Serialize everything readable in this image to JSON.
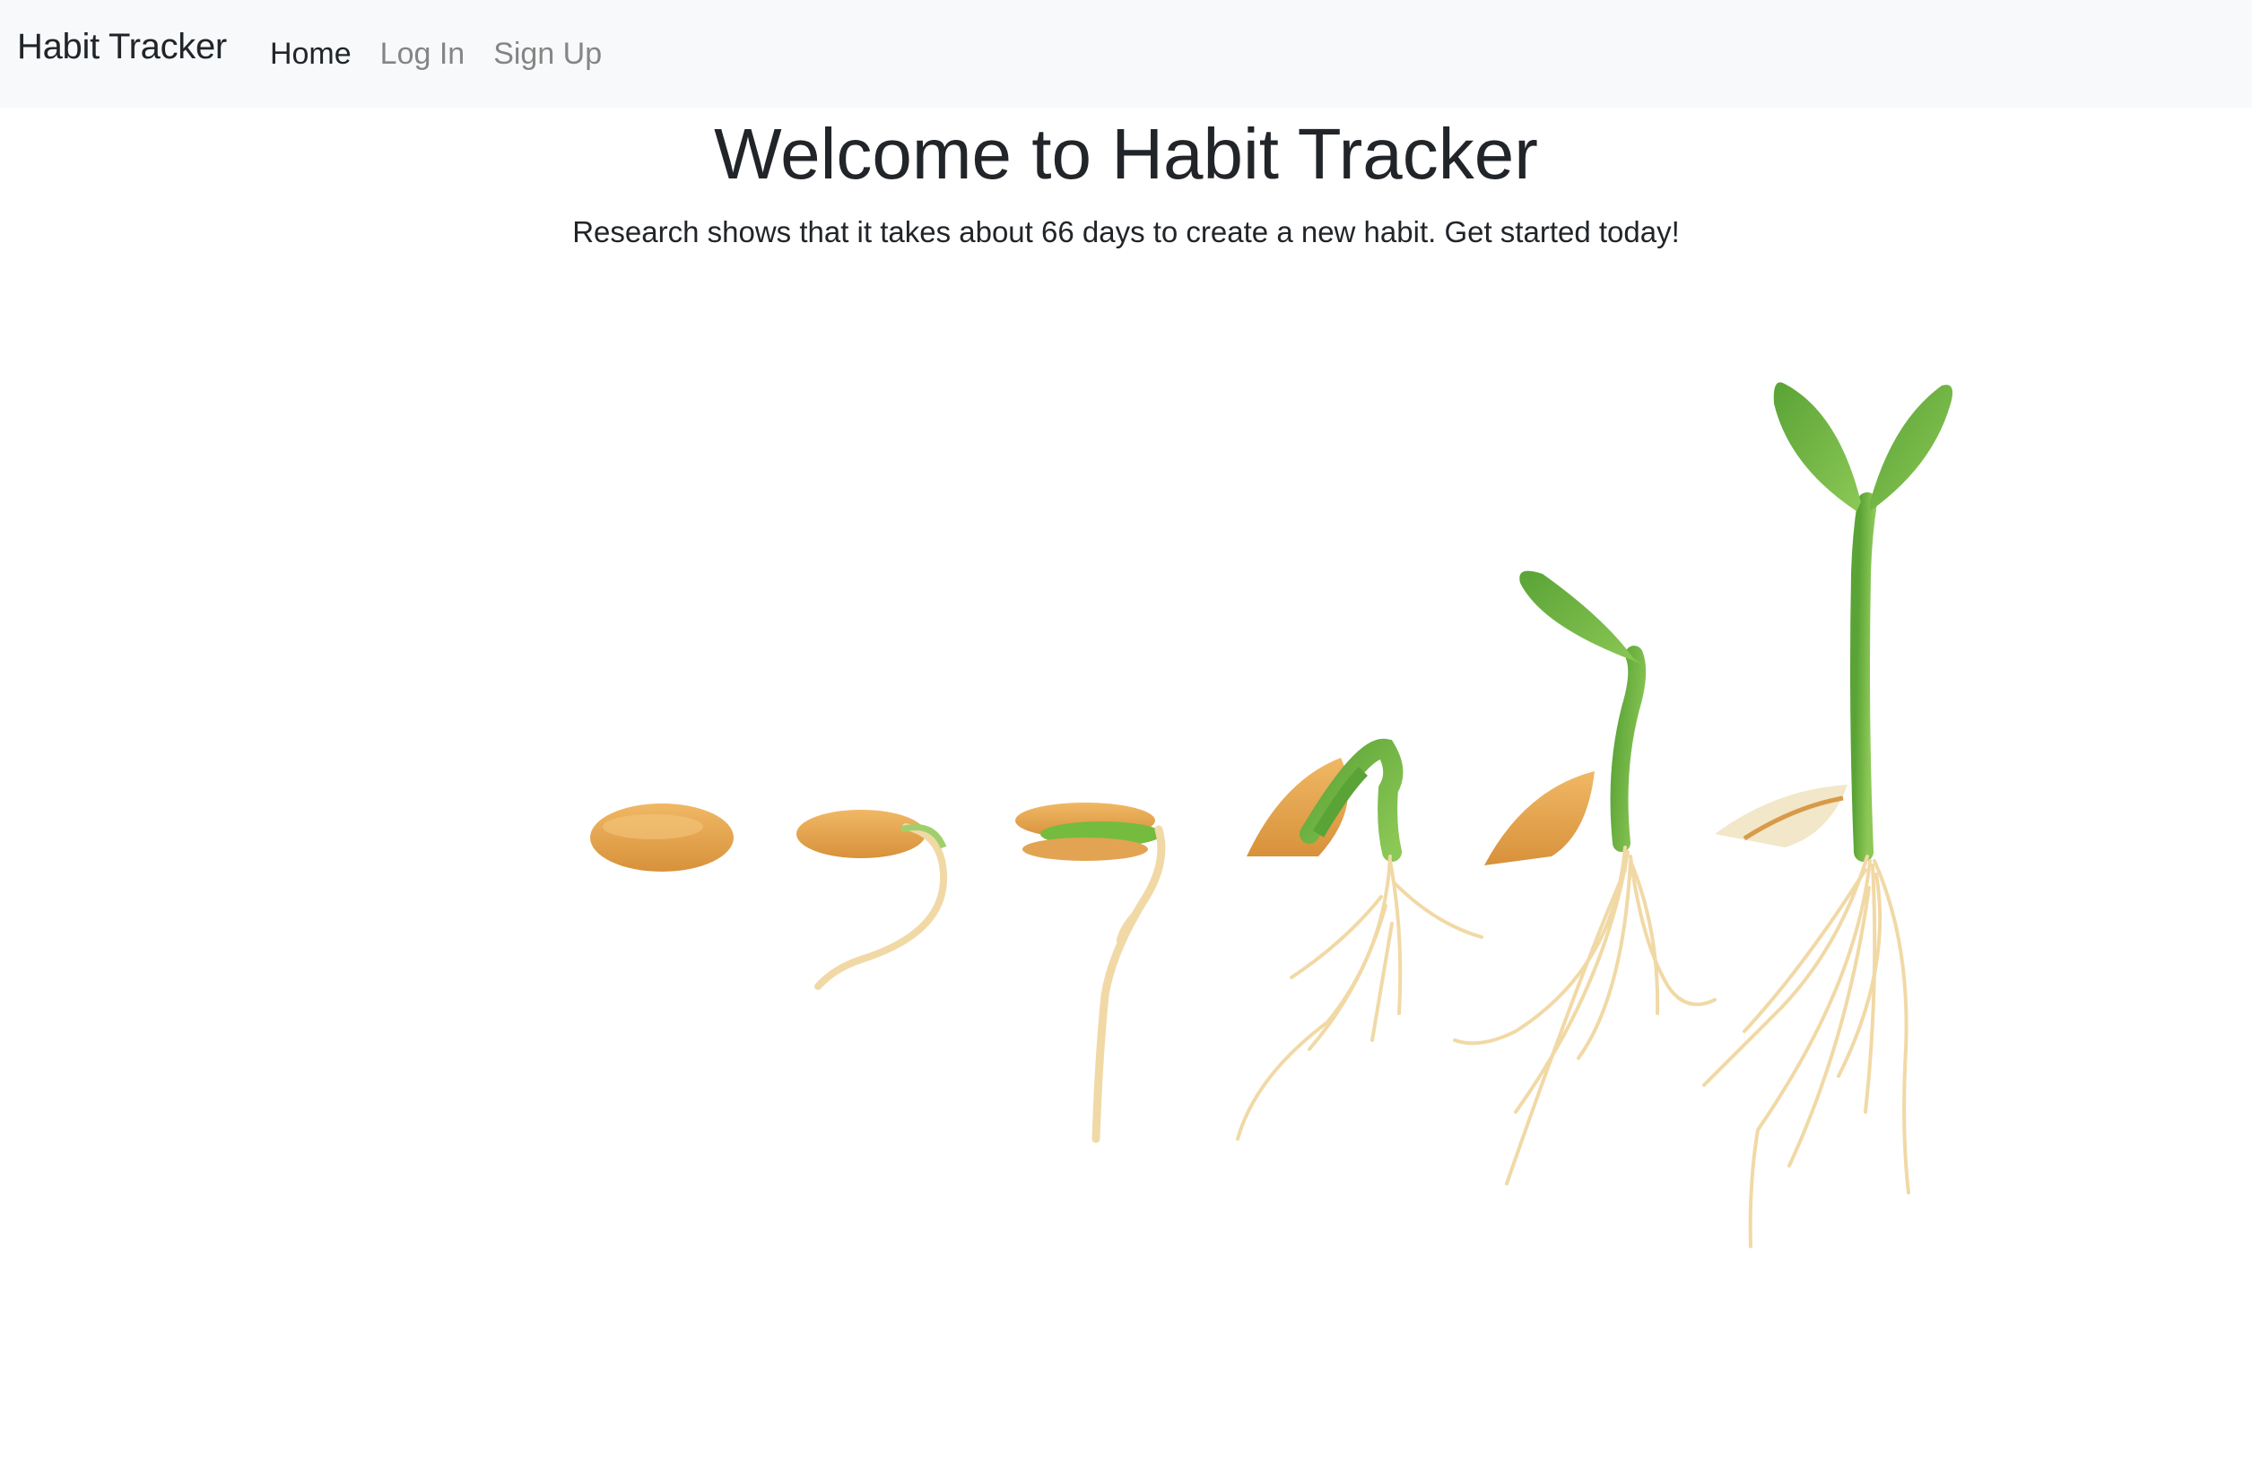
{
  "navbar": {
    "brand": "Habit Tracker",
    "links": [
      {
        "label": "Home",
        "active": true
      },
      {
        "label": "Log In",
        "active": false
      },
      {
        "label": "Sign Up",
        "active": false
      }
    ]
  },
  "hero": {
    "title": "Welcome to Habit Tracker",
    "subtitle": "Research shows that it takes about 66 days to create a new habit. Get started today!"
  },
  "colors": {
    "navbar_bg": "#f8f9fa",
    "text": "#212529",
    "muted_link": "#858585",
    "seed": "#e9a64a",
    "leaf": "#6cb33f",
    "root": "#f1d9a6"
  }
}
